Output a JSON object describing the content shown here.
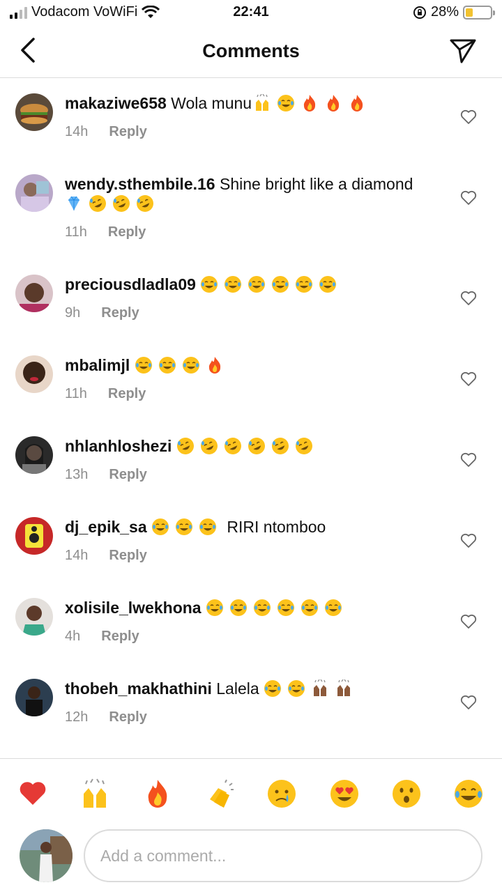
{
  "status_bar": {
    "carrier": "Vodacom VoWiFi",
    "time": "22:41",
    "battery_percent": "28%",
    "battery_level": 0.28
  },
  "header": {
    "title": "Comments"
  },
  "comments": [
    {
      "username": "makaziwe658",
      "text": "Wola munu",
      "emojis": [
        "raising-hands",
        "joy",
        "fire",
        "fire",
        "fire"
      ],
      "emoji_inline": true,
      "time": "14h",
      "reply_label": "Reply"
    },
    {
      "username": "wendy.sthembile.16",
      "text": "Shine bright like a diamond",
      "emojis": [
        "gem",
        "rofl",
        "rofl",
        "rofl"
      ],
      "time": "11h",
      "reply_label": "Reply"
    },
    {
      "username": "preciousdladla09",
      "text": "",
      "emojis": [
        "joy",
        "joy",
        "joy",
        "joy",
        "joy",
        "joy"
      ],
      "time": "9h",
      "reply_label": "Reply"
    },
    {
      "username": "mbalimjl",
      "text": "",
      "emojis": [
        "joy",
        "joy",
        "joy",
        "fire"
      ],
      "time": "11h",
      "reply_label": "Reply"
    },
    {
      "username": "nhlanhloshezi",
      "text": "",
      "emojis": [
        "rofl",
        "rofl",
        "rofl",
        "rofl",
        "rofl",
        "rofl"
      ],
      "time": "13h",
      "reply_label": "Reply"
    },
    {
      "username": "dj_epik_sa",
      "text": "RIRI ntomboo",
      "emojis_before": [
        "joy",
        "joy",
        "joy"
      ],
      "time": "14h",
      "reply_label": "Reply"
    },
    {
      "username": "xolisile_lwekhona",
      "text": "",
      "emojis": [
        "joy",
        "joy",
        "joy",
        "joy",
        "joy",
        "joy"
      ],
      "time": "4h",
      "reply_label": "Reply"
    },
    {
      "username": "thobeh_makhathini",
      "text": "Lalela",
      "emojis": [
        "joy",
        "joy",
        "raising-hands-dark",
        "raising-hands-dark"
      ],
      "time": "12h",
      "reply_label": "Reply"
    }
  ],
  "reactions": [
    "heart",
    "raising-hands",
    "fire",
    "clapping-hands",
    "crying",
    "heart-eyes",
    "surprised",
    "joy"
  ],
  "composer": {
    "placeholder": "Add a comment..."
  },
  "colors": {
    "muted_text": "#8e8e8e",
    "divider": "#dbdbdb",
    "emoji_yellow": "#fcc21b",
    "fire_orange": "#f4511e"
  }
}
